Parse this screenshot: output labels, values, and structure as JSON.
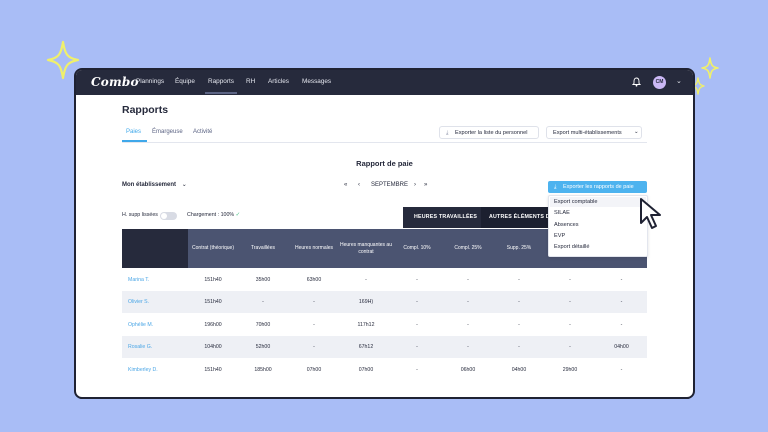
{
  "colors": {
    "background": "#a9bdf6",
    "nav": "#262a3c",
    "accent": "#3fa8ea",
    "primary_button": "#4db3ef",
    "table_header": "#4b5471"
  },
  "nav": {
    "logo": "Combo",
    "items": [
      "Plannings",
      "Équipe",
      "Rapports",
      "RH",
      "Articles",
      "Messages"
    ],
    "active": "Rapports",
    "avatar": "CM",
    "icons": [
      "bell-icon",
      "chevron-down-icon"
    ]
  },
  "page": {
    "title": "Rapports",
    "tabs": [
      "Paies",
      "Émargeuse",
      "Activité"
    ],
    "active_tab": "Paies",
    "export_staff_label": "Exporter la liste du personnel",
    "export_multi_label": "Export multi-établissements"
  },
  "report": {
    "title": "Rapport de paie",
    "establishment": "Mon établissement",
    "month": "SEPTEMBRE",
    "export_button": "Exporter les rapports de paie",
    "export_menu": [
      "Export comptable",
      "SILAE",
      "Absences",
      "EVP",
      "Export détaillé"
    ],
    "toggle_label": "H. supp lissées",
    "loading_label": "Chargement : 100%",
    "group_headers": [
      "HEURES TRAVAILLÉES",
      "AUTRES ÉLÉMENTS DE"
    ],
    "columns": [
      "Contrat (théorique)",
      "Travaillées",
      "Heures normales",
      "Heures manquantes au contrat",
      "Compl. 10%",
      "Compl. 25%",
      "Supp. 25%",
      "",
      ""
    ],
    "rows": [
      {
        "name": "Marina T.",
        "cells": [
          "151h40",
          "35h00",
          "63h00",
          "-",
          "-",
          "-",
          "-",
          "-",
          "-"
        ]
      },
      {
        "name": "Olivier S.",
        "cells": [
          "151h40",
          "-",
          "-",
          "169H)",
          "-",
          "-",
          "-",
          "-",
          "-"
        ]
      },
      {
        "name": "Ophélie M.",
        "cells": [
          "196h00",
          "70h00",
          "-",
          "117h12",
          "-",
          "-",
          "-",
          "-",
          "-"
        ]
      },
      {
        "name": "Rosalie G.",
        "cells": [
          "104h00",
          "52h00",
          "-",
          "67h12",
          "-",
          "-",
          "-",
          "-",
          "04h00"
        ]
      },
      {
        "name": "Kimberley D.",
        "cells": [
          "151h40",
          "185h00",
          "07h00",
          "07h00",
          "-",
          "06h00",
          "04h00",
          "29h00",
          "-"
        ]
      }
    ]
  }
}
